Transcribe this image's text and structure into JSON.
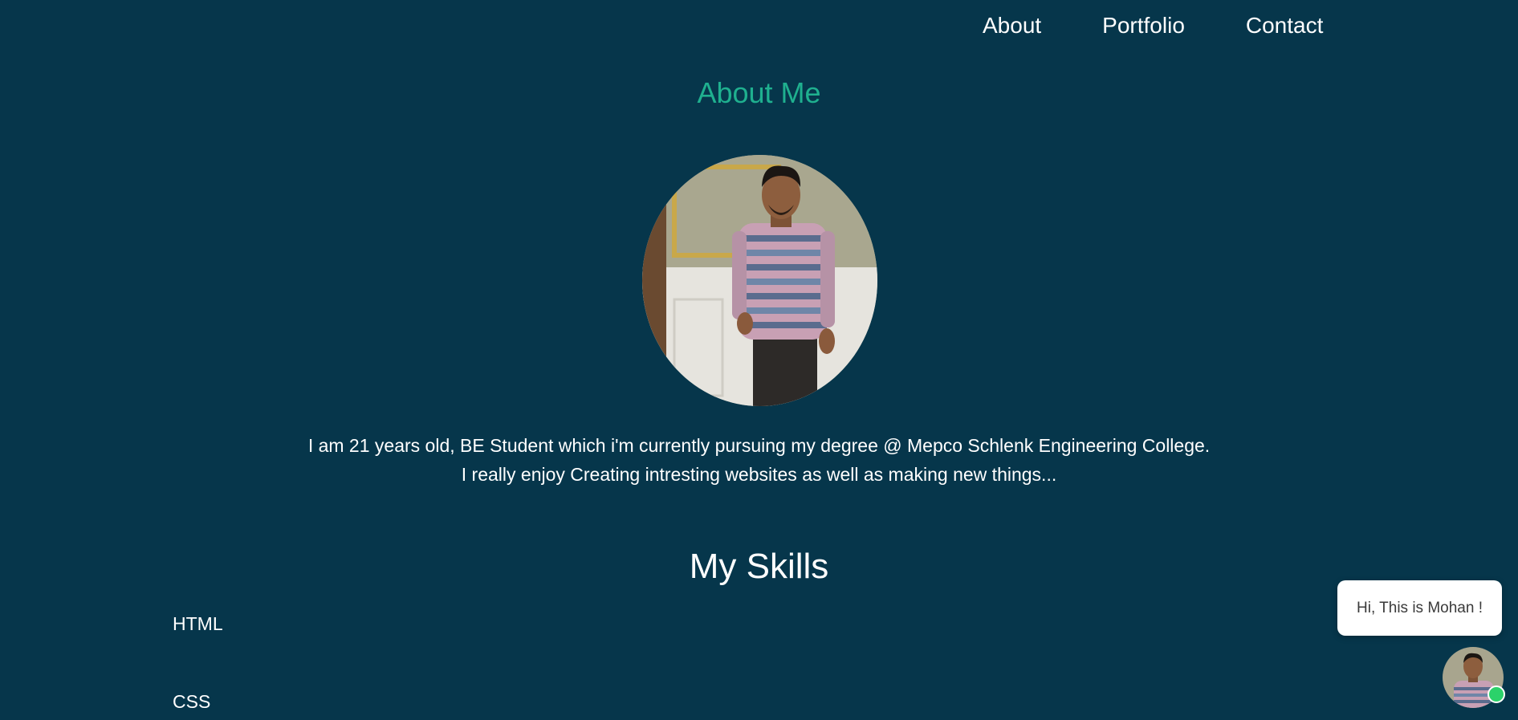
{
  "nav": {
    "about_label": "About",
    "portfolio_label": "Portfolio",
    "contact_label": "Contact"
  },
  "about": {
    "title": "About Me",
    "bio_line_1": "I am 21 years old, BE Student which i'm currently pursuing my degree @ Mepco Schlenk Engineering College.",
    "bio_line_2": "I really enjoy Creating intresting websites as well as making new things..."
  },
  "skills": {
    "title": "My Skills",
    "items": [
      "HTML",
      "CSS"
    ]
  },
  "chat": {
    "greeting": "Hi, This is Mohan !",
    "status_color": "#2bd26a"
  },
  "colors": {
    "background": "#06364b",
    "accent": "#1fb08f",
    "text": "#ffffff"
  }
}
